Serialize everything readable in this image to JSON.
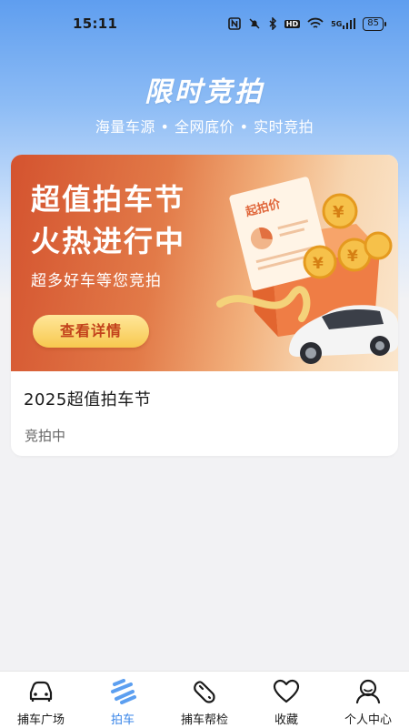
{
  "status_bar": {
    "time": "15:11",
    "icons": [
      "nfc-icon",
      "mute-icon",
      "bluetooth-icon",
      "hd-icon",
      "wifi-icon",
      "5g-signal-icon",
      "battery-icon"
    ],
    "hd_label": "HD",
    "network_label": "5G",
    "battery": "85"
  },
  "header": {
    "title": "限时竞拍",
    "subtitle": "海量车源 • 全网底价 • 实时竞拍"
  },
  "auction_card": {
    "banner": {
      "headline_line1": "超值拍车节",
      "headline_line2": "火热进行中",
      "subline": "超多好车等您竞拍",
      "button_label": "查看详情",
      "document_label": "起拍价"
    },
    "title": "2025超值拍车节",
    "status": "竞拍中"
  },
  "tabbar": {
    "items": [
      {
        "label": "捕车广场",
        "icon": "car-front-icon",
        "active": false
      },
      {
        "label": "拍车",
        "icon": "auction-icon",
        "active": true
      },
      {
        "label": "捕车帮检",
        "icon": "wrench-icon",
        "active": false
      },
      {
        "label": "收藏",
        "icon": "heart-icon",
        "active": false
      },
      {
        "label": "个人中心",
        "icon": "person-icon",
        "active": false
      }
    ]
  },
  "colors": {
    "accent": "#3a86e8",
    "banner_red": "#d4532f",
    "button_yellow": "#f7c84f",
    "button_text": "#c2421b"
  }
}
